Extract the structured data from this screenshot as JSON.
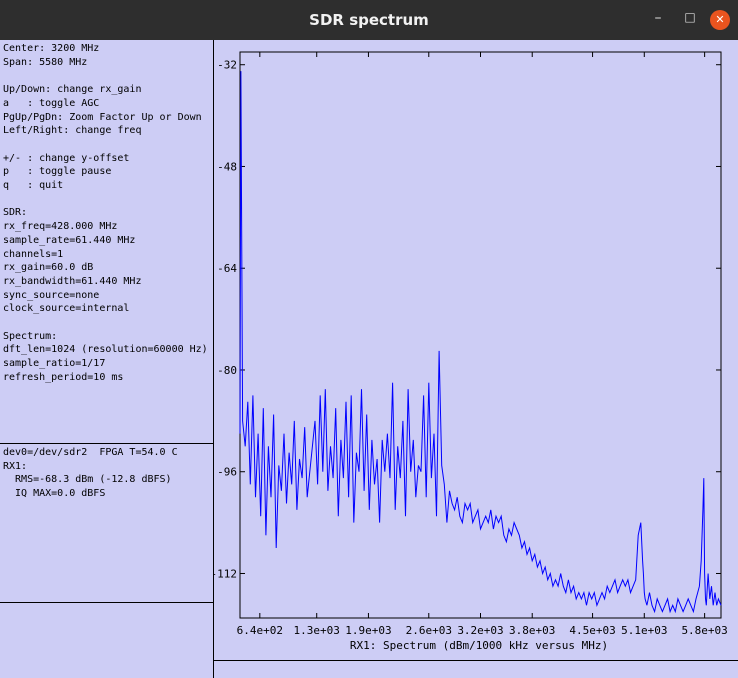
{
  "window": {
    "title": "SDR spectrum",
    "minimize_glyph": "–",
    "maximize_glyph": "□",
    "close_glyph": "✕",
    "close_color": "#e9541f"
  },
  "info_text": "Center: 3200 MHz\nSpan: 5580 MHz\n\nUp/Down: change rx_gain\na   : toggle AGC\nPgUp/PgDn: Zoom Factor Up or Down\nLeft/Right: change freq\n\n+/- : change y-offset\np   : toggle pause\nq   : quit\n\nSDR:\nrx_freq=428.000 MHz\nsample_rate=61.440 MHz\nchannels=1\nrx_gain=60.0 dB\nrx_bandwidth=61.440 MHz\nsync_source=none\nclock_source=internal\n\nSpectrum:\ndft_len=1024 (resolution=60000 Hz)\nsample_ratio=1/17\nrefresh_period=10 ms",
  "status_text": "dev0=/dev/sdr2  FPGA T=54.0 C\nRX1:\n  RMS=-68.3 dBm (-12.8 dBFS)\n  IQ MAX=0.0 dBFS",
  "chart_data": {
    "type": "line",
    "xlabel": "RX1: Spectrum (dBm/1000 kHz versus MHz)",
    "ylabel": "",
    "xlim": [
      410,
      5990
    ],
    "ylim": [
      -119,
      -30
    ],
    "y_ticks": [
      -32,
      -48,
      -64,
      -80,
      -96,
      -112
    ],
    "y_tick_labels": [
      "-32",
      "-48",
      "-64",
      "-80",
      "-96",
      "-112"
    ],
    "x_ticks": [
      640,
      1300,
      1900,
      2600,
      3200,
      3800,
      4500,
      5100,
      5800
    ],
    "x_tick_labels": [
      "6.4e+02",
      "1.3e+03",
      "1.9e+03",
      "2.6e+03",
      "3.2e+03",
      "3.8e+03",
      "4.5e+03",
      "5.1e+03",
      "5.8e+03"
    ],
    "line_color": "#0000ff",
    "grid": false,
    "series": [
      {
        "x": [
          410,
          420,
          440,
          470,
          500,
          530,
          560,
          590,
          620,
          650,
          680,
          710,
          740,
          770,
          800,
          830,
          860,
          890,
          920,
          950,
          980,
          1010,
          1040,
          1070,
          1100,
          1130,
          1160,
          1190,
          1220,
          1250,
          1280,
          1310,
          1340,
          1370,
          1400,
          1430,
          1460,
          1490,
          1520,
          1550,
          1580,
          1610,
          1640,
          1670,
          1700,
          1730,
          1760,
          1790,
          1820,
          1850,
          1880,
          1910,
          1940,
          1970,
          2000,
          2030,
          2060,
          2090,
          2120,
          2150,
          2180,
          2210,
          2240,
          2270,
          2300,
          2330,
          2360,
          2390,
          2420,
          2450,
          2480,
          2510,
          2540,
          2570,
          2600,
          2630,
          2660,
          2690,
          2720,
          2750,
          2780,
          2810,
          2840,
          2870,
          2900,
          2930,
          2960,
          2990,
          3020,
          3050,
          3080,
          3110,
          3140,
          3170,
          3200,
          3230,
          3260,
          3290,
          3320,
          3350,
          3380,
          3410,
          3440,
          3470,
          3500,
          3530,
          3560,
          3590,
          3620,
          3650,
          3680,
          3710,
          3740,
          3770,
          3800,
          3830,
          3860,
          3890,
          3920,
          3950,
          3980,
          4010,
          4040,
          4070,
          4100,
          4130,
          4160,
          4190,
          4220,
          4250,
          4280,
          4310,
          4340,
          4370,
          4400,
          4430,
          4460,
          4490,
          4520,
          4550,
          4580,
          4610,
          4640,
          4670,
          4700,
          4730,
          4760,
          4790,
          4820,
          4850,
          4880,
          4910,
          4940,
          4970,
          5000,
          5030,
          5060,
          5080,
          5090,
          5100,
          5110,
          5130,
          5160,
          5190,
          5220,
          5250,
          5280,
          5310,
          5340,
          5370,
          5400,
          5430,
          5460,
          5490,
          5520,
          5550,
          5580,
          5610,
          5640,
          5670,
          5700,
          5720,
          5740,
          5760,
          5780,
          5790,
          5800,
          5810,
          5820,
          5840,
          5860,
          5880,
          5900,
          5920,
          5940,
          5960,
          5990
        ],
        "y": [
          -90,
          -33,
          -88,
          -92,
          -85,
          -98,
          -84,
          -100,
          -90,
          -103,
          -86,
          -106,
          -92,
          -100,
          -87,
          -108,
          -95,
          -99,
          -90,
          -101,
          -93,
          -98,
          -88,
          -102,
          -94,
          -97,
          -89,
          -100,
          -96,
          -92,
          -88,
          -98,
          -84,
          -96,
          -83,
          -99,
          -92,
          -97,
          -86,
          -103,
          -91,
          -97,
          -85,
          -100,
          -84,
          -104,
          -93,
          -96,
          -83,
          -99,
          -87,
          -102,
          -91,
          -98,
          -94,
          -104,
          -91,
          -96,
          -90,
          -97,
          -82,
          -102,
          -92,
          -97,
          -88,
          -103,
          -83,
          -96,
          -91,
          -100,
          -95,
          -96,
          -84,
          -100,
          -82,
          -97,
          -90,
          -103,
          -77,
          -95,
          -98,
          -104,
          -99,
          -101,
          -102,
          -100,
          -103,
          -104,
          -101,
          -102,
          -101,
          -104,
          -103,
          -102,
          -105,
          -104,
          -103,
          -104,
          -102,
          -105,
          -103,
          -104,
          -103,
          -106,
          -107,
          -105,
          -106,
          -104,
          -105,
          -106,
          -108,
          -107,
          -109,
          -108,
          -110,
          -109,
          -111,
          -110,
          -112,
          -111,
          -113,
          -112,
          -114,
          -113,
          -114,
          -112,
          -114,
          -115,
          -113,
          -115,
          -114,
          -116,
          -115,
          -116,
          -115,
          -117,
          -115,
          -116,
          -115,
          -117,
          -116,
          -115,
          -116,
          -114,
          -115,
          -114,
          -113,
          -115,
          -114,
          -113,
          -114,
          -113,
          -115,
          -114,
          -113,
          -106,
          -104,
          -110,
          -112,
          -115,
          -116,
          -117,
          -115,
          -117,
          -118,
          -116,
          -117,
          -118,
          -117,
          -116,
          -118,
          -117,
          -118,
          -116,
          -117,
          -118,
          -117,
          -116,
          -117,
          -118,
          -116,
          -115,
          -114,
          -110,
          -102,
          -97,
          -112,
          -116,
          -117,
          -112,
          -116,
          -114,
          -117,
          -115,
          -117,
          -116,
          -117
        ]
      }
    ]
  }
}
